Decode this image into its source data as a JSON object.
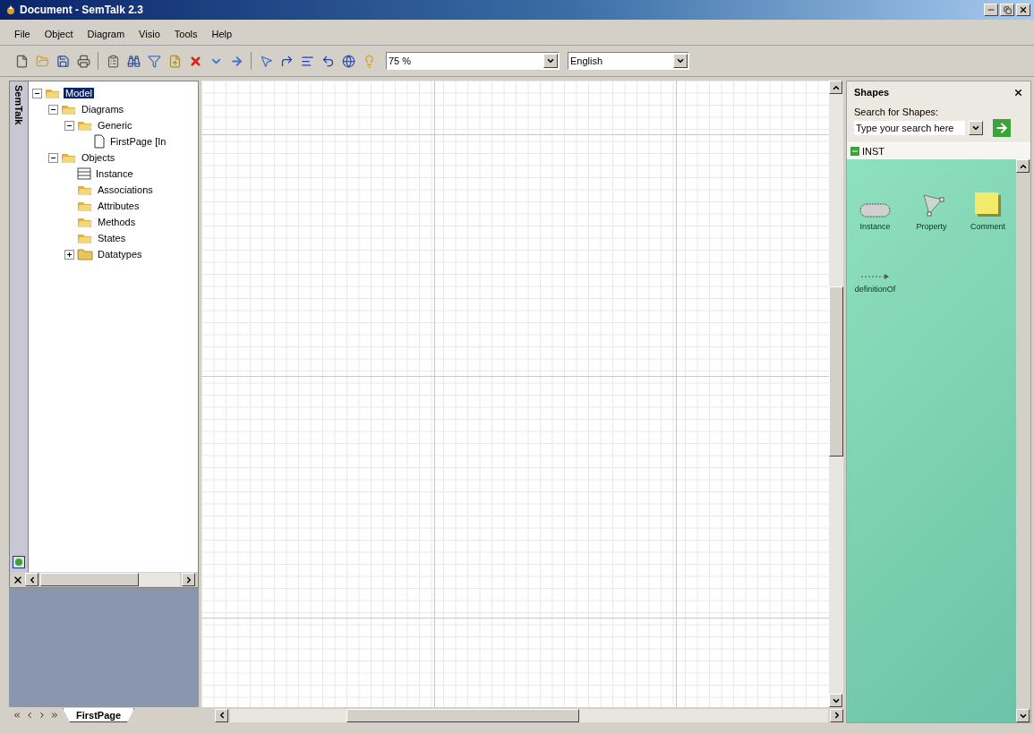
{
  "window": {
    "title": "Document - SemTalk 2.3"
  },
  "menu": [
    "File",
    "Object",
    "Diagram",
    "Visio",
    "Tools",
    "Help"
  ],
  "toolbar": {
    "zoom": "75 %",
    "language": "English"
  },
  "side_panel": {
    "title": "SemTalk",
    "tree": [
      {
        "label": "Model",
        "kind": "folder",
        "expanded": true,
        "selected": true,
        "children": [
          {
            "label": "Diagrams",
            "kind": "folder",
            "expanded": true,
            "selected": false,
            "children": [
              {
                "label": "Generic",
                "kind": "folder",
                "expanded": true,
                "selected": false,
                "children": [
                  {
                    "label": "FirstPage [In",
                    "kind": "page",
                    "selected": false
                  }
                ]
              }
            ]
          },
          {
            "label": "Objects",
            "kind": "folder",
            "expanded": true,
            "selected": false,
            "children": [
              {
                "label": "Instance",
                "kind": "class",
                "selected": false
              },
              {
                "label": "Associations",
                "kind": "folder",
                "selected": false
              },
              {
                "label": "Attributes",
                "kind": "folder",
                "selected": false
              },
              {
                "label": "Methods",
                "kind": "folder",
                "selected": false
              },
              {
                "label": "States",
                "kind": "folder",
                "selected": false
              },
              {
                "label": "Datatypes",
                "kind": "closed-folder",
                "expanded": false,
                "selected": false
              }
            ]
          }
        ]
      }
    ]
  },
  "page_tabs": [
    {
      "label": "FirstPage",
      "selected": true
    }
  ],
  "shapes_panel": {
    "title": "Shapes",
    "search_label": "Search for Shapes:",
    "search": {
      "placeholder": "Type your search here"
    },
    "stencil": {
      "title": "INST",
      "shapes": [
        {
          "label": "Instance",
          "kind": "instance"
        },
        {
          "label": "Property",
          "kind": "property"
        },
        {
          "label": "Comment",
          "kind": "comment"
        },
        {
          "label": "definitionOf",
          "kind": "connector"
        }
      ]
    }
  }
}
